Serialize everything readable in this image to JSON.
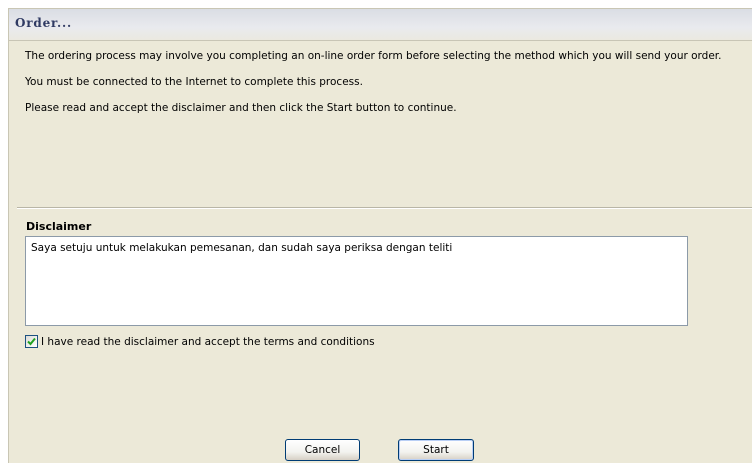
{
  "dialog": {
    "title": "Order..."
  },
  "intro": {
    "paragraph_1": "The ordering process may involve you completing an on-line order form before selecting the method which you will send your order.",
    "paragraph_2": "You must be connected to the Internet to complete this process.",
    "paragraph_3": "Please read and accept the disclaimer and then click the Start button to continue."
  },
  "disclaimer": {
    "label": "Disclaimer",
    "text": "Saya setuju untuk melakukan pemesanan, dan sudah saya periksa dengan teliti"
  },
  "accept": {
    "label": "I have read the disclaimer and accept the terms and conditions",
    "checked": true
  },
  "buttons": {
    "cancel_label": "Cancel",
    "start_label": "Start"
  }
}
